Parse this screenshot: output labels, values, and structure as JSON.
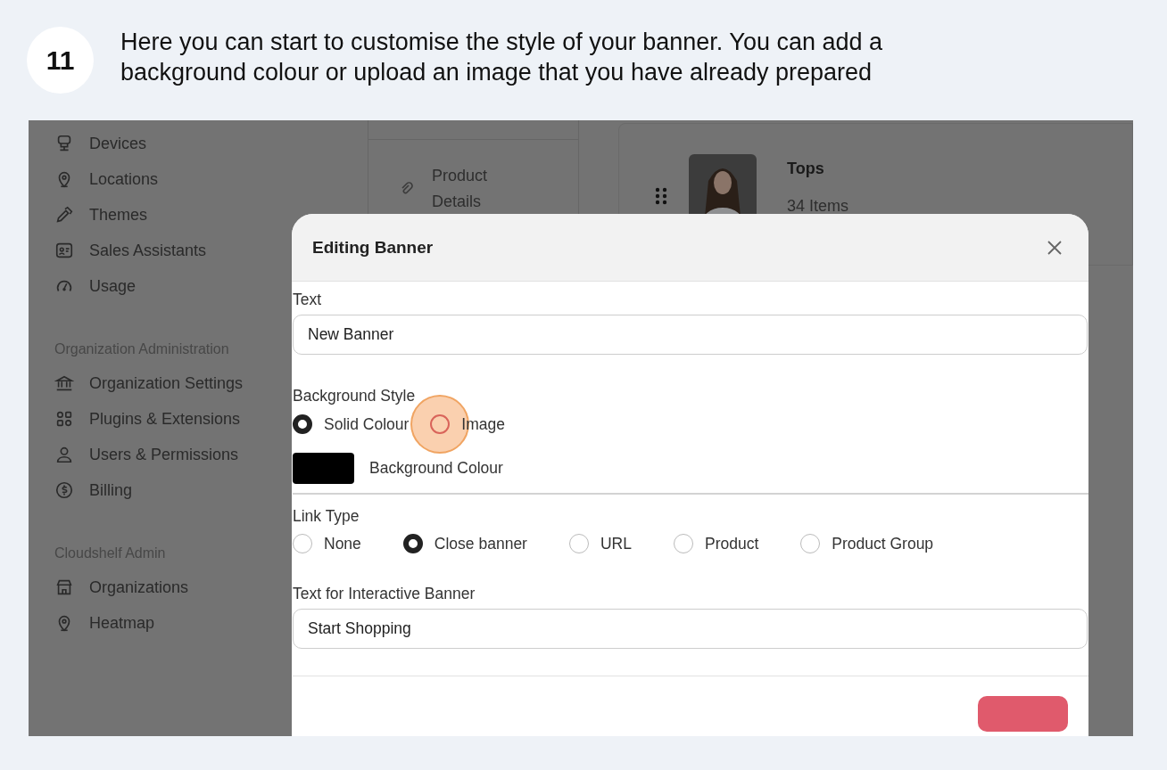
{
  "step": {
    "number": "11",
    "text": "Here you can start to customise the style of your banner. You can add a background colour or upload an image that you have already prepared"
  },
  "sidebar": {
    "sections": [
      {
        "items": [
          {
            "label": "Devices"
          },
          {
            "label": "Locations"
          },
          {
            "label": "Themes"
          },
          {
            "label": "Sales Assistants"
          },
          {
            "label": "Usage"
          }
        ]
      },
      {
        "heading": "Organization Administration",
        "items": [
          {
            "label": "Organization Settings"
          },
          {
            "label": "Plugins & Extensions"
          },
          {
            "label": "Users & Permissions"
          },
          {
            "label": "Billing"
          }
        ]
      },
      {
        "heading": "Cloudshelf Admin",
        "items": [
          {
            "label": "Organizations"
          },
          {
            "label": "Heatmap"
          }
        ]
      }
    ]
  },
  "middle_panel": {
    "items": [
      {
        "label": "Product Details"
      }
    ]
  },
  "collection_card": {
    "title": "Tops",
    "count": "34 Items"
  },
  "modal": {
    "title": "Editing Banner",
    "text_field": {
      "label": "Text",
      "value": "New Banner"
    },
    "background_style": {
      "label": "Background Style",
      "options": [
        {
          "label": "Solid Colour",
          "selected": true,
          "highlighted": false
        },
        {
          "label": "Image",
          "selected": false,
          "highlighted": true
        }
      ]
    },
    "background_colour": {
      "label": "Background Colour",
      "color": "#000000"
    },
    "link_type": {
      "label": "Link Type",
      "options": [
        {
          "label": "None",
          "selected": false
        },
        {
          "label": "Close banner",
          "selected": true
        },
        {
          "label": "URL",
          "selected": false
        },
        {
          "label": "Product",
          "selected": false
        },
        {
          "label": "Product Group",
          "selected": false
        }
      ]
    },
    "interactive_text": {
      "label": "Text for Interactive Banner",
      "value": "Start Shopping"
    }
  }
}
